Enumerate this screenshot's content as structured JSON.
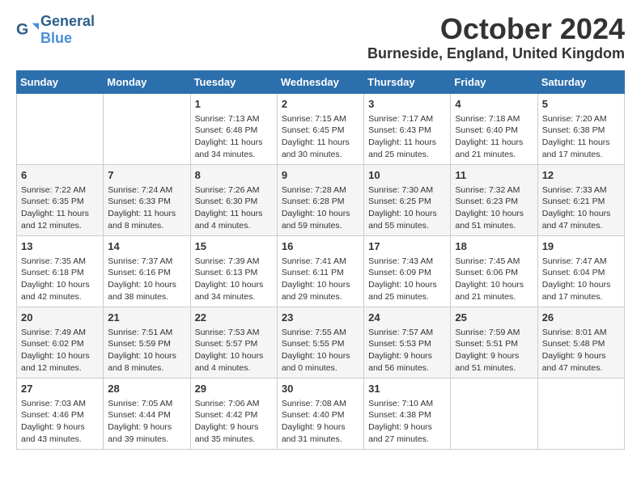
{
  "header": {
    "logo_general": "General",
    "logo_blue": "Blue",
    "month_title": "October 2024",
    "location": "Burneside, England, United Kingdom"
  },
  "days_of_week": [
    "Sunday",
    "Monday",
    "Tuesday",
    "Wednesday",
    "Thursday",
    "Friday",
    "Saturday"
  ],
  "weeks": [
    [
      {
        "day": "",
        "sunrise": "",
        "sunset": "",
        "daylight": ""
      },
      {
        "day": "",
        "sunrise": "",
        "sunset": "",
        "daylight": ""
      },
      {
        "day": "1",
        "sunrise": "Sunrise: 7:13 AM",
        "sunset": "Sunset: 6:48 PM",
        "daylight": "Daylight: 11 hours and 34 minutes."
      },
      {
        "day": "2",
        "sunrise": "Sunrise: 7:15 AM",
        "sunset": "Sunset: 6:45 PM",
        "daylight": "Daylight: 11 hours and 30 minutes."
      },
      {
        "day": "3",
        "sunrise": "Sunrise: 7:17 AM",
        "sunset": "Sunset: 6:43 PM",
        "daylight": "Daylight: 11 hours and 25 minutes."
      },
      {
        "day": "4",
        "sunrise": "Sunrise: 7:18 AM",
        "sunset": "Sunset: 6:40 PM",
        "daylight": "Daylight: 11 hours and 21 minutes."
      },
      {
        "day": "5",
        "sunrise": "Sunrise: 7:20 AM",
        "sunset": "Sunset: 6:38 PM",
        "daylight": "Daylight: 11 hours and 17 minutes."
      }
    ],
    [
      {
        "day": "6",
        "sunrise": "Sunrise: 7:22 AM",
        "sunset": "Sunset: 6:35 PM",
        "daylight": "Daylight: 11 hours and 12 minutes."
      },
      {
        "day": "7",
        "sunrise": "Sunrise: 7:24 AM",
        "sunset": "Sunset: 6:33 PM",
        "daylight": "Daylight: 11 hours and 8 minutes."
      },
      {
        "day": "8",
        "sunrise": "Sunrise: 7:26 AM",
        "sunset": "Sunset: 6:30 PM",
        "daylight": "Daylight: 11 hours and 4 minutes."
      },
      {
        "day": "9",
        "sunrise": "Sunrise: 7:28 AM",
        "sunset": "Sunset: 6:28 PM",
        "daylight": "Daylight: 10 hours and 59 minutes."
      },
      {
        "day": "10",
        "sunrise": "Sunrise: 7:30 AM",
        "sunset": "Sunset: 6:25 PM",
        "daylight": "Daylight: 10 hours and 55 minutes."
      },
      {
        "day": "11",
        "sunrise": "Sunrise: 7:32 AM",
        "sunset": "Sunset: 6:23 PM",
        "daylight": "Daylight: 10 hours and 51 minutes."
      },
      {
        "day": "12",
        "sunrise": "Sunrise: 7:33 AM",
        "sunset": "Sunset: 6:21 PM",
        "daylight": "Daylight: 10 hours and 47 minutes."
      }
    ],
    [
      {
        "day": "13",
        "sunrise": "Sunrise: 7:35 AM",
        "sunset": "Sunset: 6:18 PM",
        "daylight": "Daylight: 10 hours and 42 minutes."
      },
      {
        "day": "14",
        "sunrise": "Sunrise: 7:37 AM",
        "sunset": "Sunset: 6:16 PM",
        "daylight": "Daylight: 10 hours and 38 minutes."
      },
      {
        "day": "15",
        "sunrise": "Sunrise: 7:39 AM",
        "sunset": "Sunset: 6:13 PM",
        "daylight": "Daylight: 10 hours and 34 minutes."
      },
      {
        "day": "16",
        "sunrise": "Sunrise: 7:41 AM",
        "sunset": "Sunset: 6:11 PM",
        "daylight": "Daylight: 10 hours and 29 minutes."
      },
      {
        "day": "17",
        "sunrise": "Sunrise: 7:43 AM",
        "sunset": "Sunset: 6:09 PM",
        "daylight": "Daylight: 10 hours and 25 minutes."
      },
      {
        "day": "18",
        "sunrise": "Sunrise: 7:45 AM",
        "sunset": "Sunset: 6:06 PM",
        "daylight": "Daylight: 10 hours and 21 minutes."
      },
      {
        "day": "19",
        "sunrise": "Sunrise: 7:47 AM",
        "sunset": "Sunset: 6:04 PM",
        "daylight": "Daylight: 10 hours and 17 minutes."
      }
    ],
    [
      {
        "day": "20",
        "sunrise": "Sunrise: 7:49 AM",
        "sunset": "Sunset: 6:02 PM",
        "daylight": "Daylight: 10 hours and 12 minutes."
      },
      {
        "day": "21",
        "sunrise": "Sunrise: 7:51 AM",
        "sunset": "Sunset: 5:59 PM",
        "daylight": "Daylight: 10 hours and 8 minutes."
      },
      {
        "day": "22",
        "sunrise": "Sunrise: 7:53 AM",
        "sunset": "Sunset: 5:57 PM",
        "daylight": "Daylight: 10 hours and 4 minutes."
      },
      {
        "day": "23",
        "sunrise": "Sunrise: 7:55 AM",
        "sunset": "Sunset: 5:55 PM",
        "daylight": "Daylight: 10 hours and 0 minutes."
      },
      {
        "day": "24",
        "sunrise": "Sunrise: 7:57 AM",
        "sunset": "Sunset: 5:53 PM",
        "daylight": "Daylight: 9 hours and 56 minutes."
      },
      {
        "day": "25",
        "sunrise": "Sunrise: 7:59 AM",
        "sunset": "Sunset: 5:51 PM",
        "daylight": "Daylight: 9 hours and 51 minutes."
      },
      {
        "day": "26",
        "sunrise": "Sunrise: 8:01 AM",
        "sunset": "Sunset: 5:48 PM",
        "daylight": "Daylight: 9 hours and 47 minutes."
      }
    ],
    [
      {
        "day": "27",
        "sunrise": "Sunrise: 7:03 AM",
        "sunset": "Sunset: 4:46 PM",
        "daylight": "Daylight: 9 hours and 43 minutes."
      },
      {
        "day": "28",
        "sunrise": "Sunrise: 7:05 AM",
        "sunset": "Sunset: 4:44 PM",
        "daylight": "Daylight: 9 hours and 39 minutes."
      },
      {
        "day": "29",
        "sunrise": "Sunrise: 7:06 AM",
        "sunset": "Sunset: 4:42 PM",
        "daylight": "Daylight: 9 hours and 35 minutes."
      },
      {
        "day": "30",
        "sunrise": "Sunrise: 7:08 AM",
        "sunset": "Sunset: 4:40 PM",
        "daylight": "Daylight: 9 hours and 31 minutes."
      },
      {
        "day": "31",
        "sunrise": "Sunrise: 7:10 AM",
        "sunset": "Sunset: 4:38 PM",
        "daylight": "Daylight: 9 hours and 27 minutes."
      },
      {
        "day": "",
        "sunrise": "",
        "sunset": "",
        "daylight": ""
      },
      {
        "day": "",
        "sunrise": "",
        "sunset": "",
        "daylight": ""
      }
    ]
  ]
}
